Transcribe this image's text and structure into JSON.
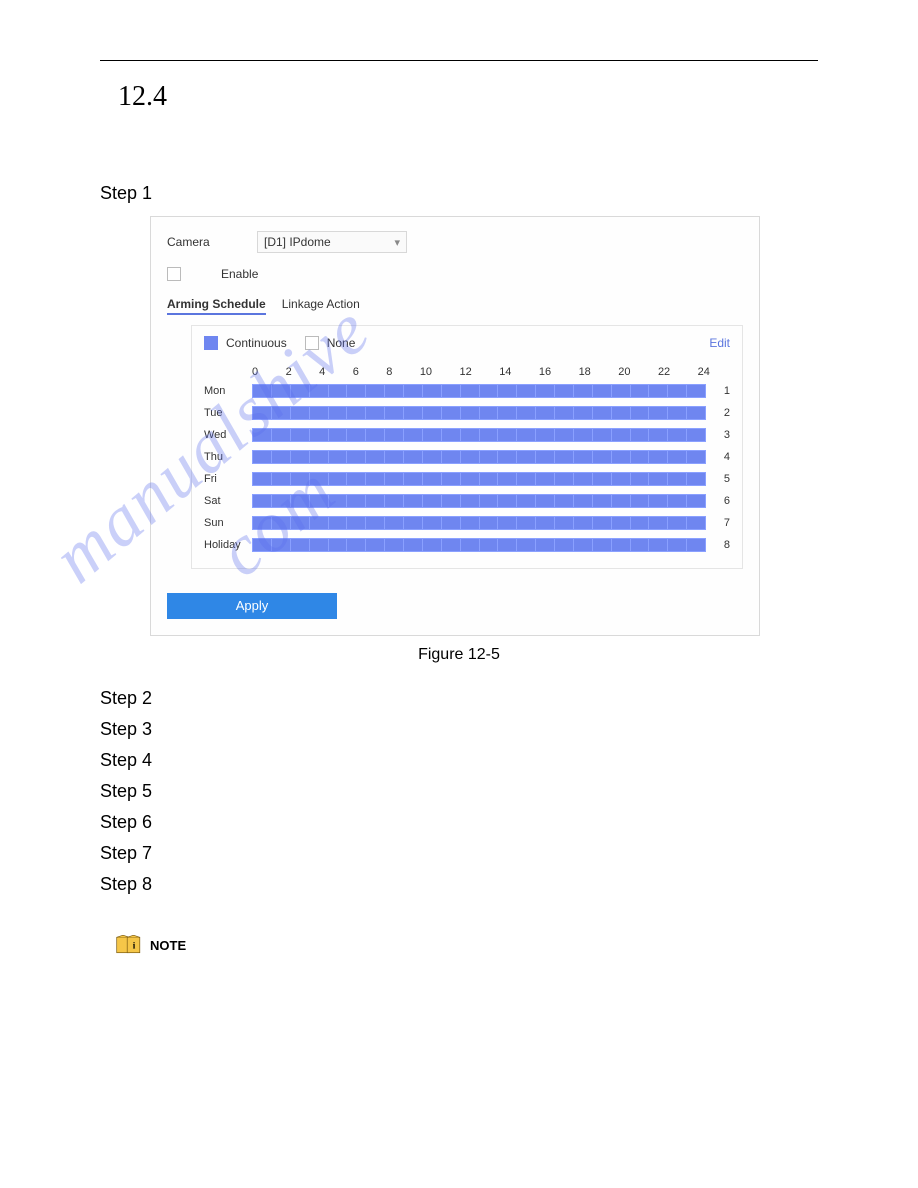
{
  "section_number": "12.4",
  "step1_label": "Step 1",
  "panel": {
    "camera_label": "Camera",
    "camera_value": "[D1] IPdome",
    "enable_label": "Enable",
    "tab_arming": "Arming Schedule",
    "tab_linkage": "Linkage Action",
    "legend_continuous": "Continuous",
    "legend_none": "None",
    "edit_link": "Edit",
    "hours": [
      "0",
      "2",
      "4",
      "6",
      "8",
      "10",
      "12",
      "14",
      "16",
      "18",
      "20",
      "22",
      "24"
    ],
    "days": [
      {
        "label": "Mon",
        "index": "1"
      },
      {
        "label": "Tue",
        "index": "2"
      },
      {
        "label": "Wed",
        "index": "3"
      },
      {
        "label": "Thu",
        "index": "4"
      },
      {
        "label": "Fri",
        "index": "5"
      },
      {
        "label": "Sat",
        "index": "6"
      },
      {
        "label": "Sun",
        "index": "7"
      },
      {
        "label": "Holiday",
        "index": "8"
      }
    ],
    "apply_label": "Apply"
  },
  "figure_caption": "Figure 12-5",
  "steps_after": [
    "Step 2",
    "Step 3",
    "Step 4",
    "Step 5",
    "Step 6",
    "Step 7",
    "Step 8"
  ],
  "note_label": "NOTE",
  "watermark_text": "manualshive.com"
}
